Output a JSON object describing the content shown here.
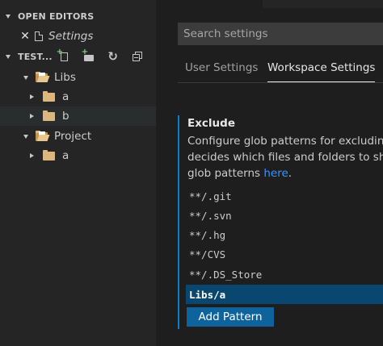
{
  "sidebar": {
    "open_editors_header": "OPEN EDITORS",
    "open_editors": [
      {
        "name": "Settings",
        "close_glyph": "✕"
      }
    ],
    "workspace_header": "TEST...",
    "toolbar": [
      "new-file-icon",
      "new-folder-icon",
      "refresh-icon",
      "collapse-all-icon"
    ],
    "tree": [
      {
        "label": "Libs",
        "expanded": true
      },
      {
        "label": "a",
        "expanded": false
      },
      {
        "label": "b",
        "expanded": false
      },
      {
        "label": "Project",
        "expanded": true
      },
      {
        "label": "a",
        "expanded": false
      }
    ]
  },
  "editor": {
    "search_placeholder": "Search settings",
    "tabs": [
      {
        "label": "User Settings",
        "active": false
      },
      {
        "label": "Workspace Settings",
        "active": true
      }
    ],
    "setting": {
      "title": "Exclude",
      "description_lines": [
        "Configure glob patterns for excluding",
        "decides which files and folders to show",
        "glob patterns "
      ],
      "link_text": "here",
      "link_suffix": ".",
      "patterns": [
        "**/.git",
        "**/.svn",
        "**/.hg",
        "**/CVS",
        "**/.DS_Store",
        "Libs/a"
      ],
      "selected_pattern": "Libs/a",
      "add_button_label": "Add Pattern"
    }
  },
  "colors": {
    "accent": "#0e639c",
    "selection": "#094771",
    "link": "#3794ff",
    "folder": "#dcb67a"
  }
}
